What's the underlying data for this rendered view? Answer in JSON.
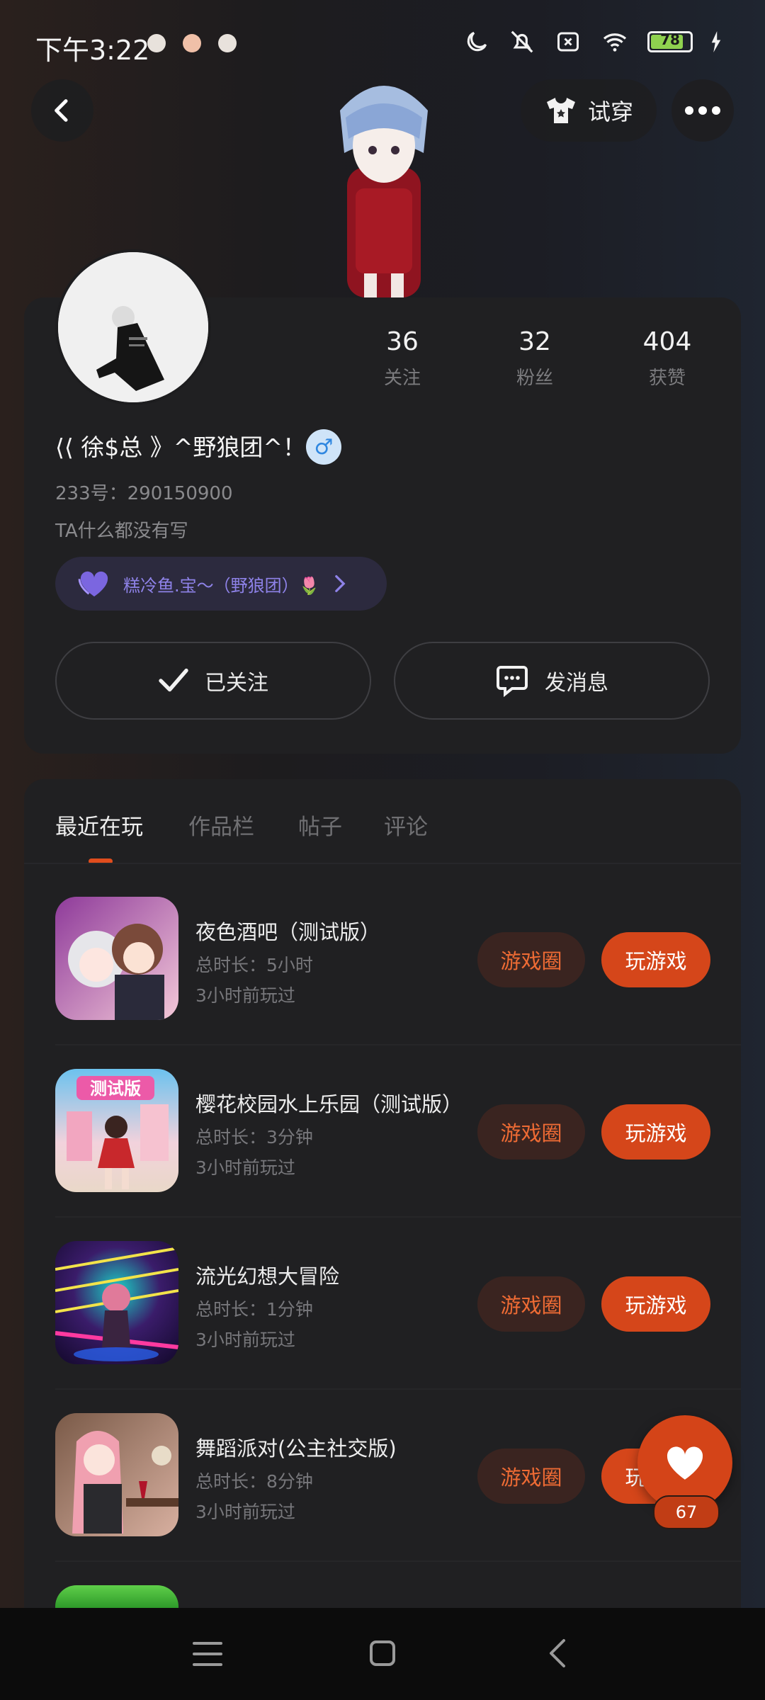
{
  "status_bar": {
    "time": "下午3:22",
    "battery": "78"
  },
  "header": {
    "try_on_label": "试穿"
  },
  "profile": {
    "stats": [
      {
        "count": "36",
        "label": "关注"
      },
      {
        "count": "32",
        "label": "粉丝"
      },
      {
        "count": "404",
        "label": "获赞"
      }
    ],
    "username": "⟨⟨ 徐$总 》^野狼团^！",
    "gender_symbol": "♂",
    "uid": "233号：290150900",
    "bio": "TA什么都没有写",
    "guardian_label": "糕冷鱼.宝～（野狼团）🌷",
    "follow_button": "已关注",
    "message_button": "发消息"
  },
  "tabs": [
    {
      "label": "最近在玩",
      "active": true
    },
    {
      "label": "作品栏",
      "active": false
    },
    {
      "label": "帖子",
      "active": false
    },
    {
      "label": "评论",
      "active": false
    }
  ],
  "games": [
    {
      "title": "夜色酒吧（测试版）",
      "duration": "总时长：5小时",
      "last_played": "3小时前玩过",
      "circle_label": "游戏圈",
      "play_label": "玩游戏",
      "icon_colors": [
        "#b85aa0",
        "#f2c6d8"
      ]
    },
    {
      "title": "樱花校园水上乐园（测试版）",
      "duration": "总时长：3分钟",
      "last_played": "3小时前玩过",
      "circle_label": "游戏圈",
      "play_label": "玩游戏",
      "icon_badge": "测试版",
      "icon_colors": [
        "#5ab8e8",
        "#f0b6c8"
      ]
    },
    {
      "title": "流光幻想大冒险",
      "duration": "总时长：1分钟",
      "last_played": "3小时前玩过",
      "circle_label": "游戏圈",
      "play_label": "玩游戏",
      "icon_colors": [
        "#2a1850",
        "#18c8c0"
      ]
    },
    {
      "title": "舞蹈派对(公主社交版)",
      "duration": "总时长：8分钟",
      "last_played": "3小时前玩过",
      "circle_label": "游戏圈",
      "play_label": "玩游戏",
      "icon_colors": [
        "#6a4a3a",
        "#f4a8b8"
      ]
    }
  ],
  "like": {
    "count": "67"
  }
}
